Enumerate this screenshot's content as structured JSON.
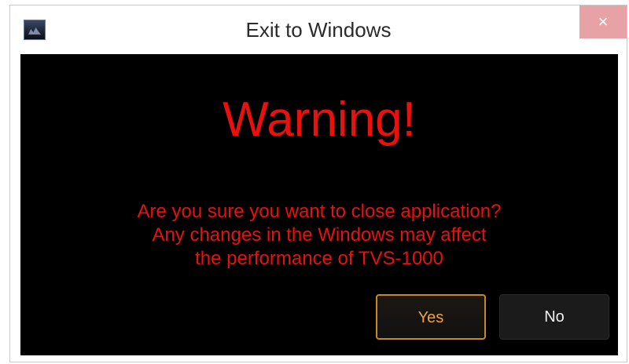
{
  "window": {
    "title": "Exit to Windows",
    "close_glyph": "×",
    "icon": "app-icon"
  },
  "dialog": {
    "heading": "Warning!",
    "message_lines": [
      "Are you sure you want to close application?",
      "Any changes in the Windows may affect",
      "the performance of TVS-1000"
    ],
    "buttons": {
      "yes": "Yes",
      "no": "No"
    }
  },
  "colors": {
    "warning_red": "#e8110e",
    "yes_accent": "#f2a23a",
    "close_button": "#e6a2a4",
    "content_bg": "#000000"
  }
}
